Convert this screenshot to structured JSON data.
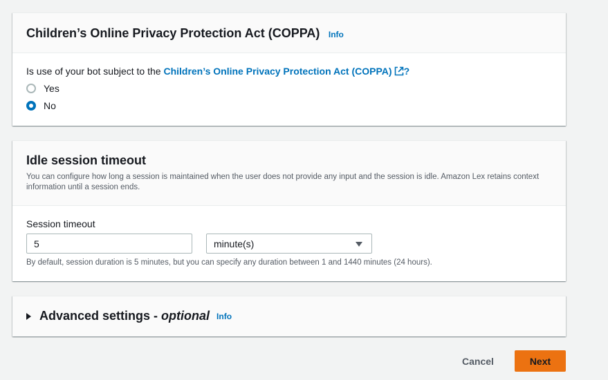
{
  "coppa": {
    "title": "Children’s Online Privacy Protection Act (COPPA)",
    "info": "Info",
    "question_prefix": "Is use of your bot subject to the ",
    "question_link": "Children’s Online Privacy Protection Act (COPPA)",
    "question_suffix": "?",
    "options": [
      {
        "label": "Yes",
        "checked": false
      },
      {
        "label": "No",
        "checked": true
      }
    ]
  },
  "idle": {
    "title": "Idle session timeout",
    "description": "You can configure how long a session is maintained when the user does not provide any input and the session is idle. Amazon Lex retains context information until a session ends.",
    "field_label": "Session timeout",
    "timeout_value": "5",
    "unit_selected": "minute(s)",
    "hint": "By default, session duration is 5 minutes, but you can specify any duration between 1 and 1440 minutes (24 hours)."
  },
  "advanced": {
    "title": "Advanced settings - ",
    "optional": "optional",
    "info": "Info"
  },
  "footer": {
    "cancel": "Cancel",
    "next": "Next"
  },
  "colors": {
    "link": "#0073bb",
    "primary_button": "#ec7211",
    "page_background": "#f2f3f3"
  }
}
